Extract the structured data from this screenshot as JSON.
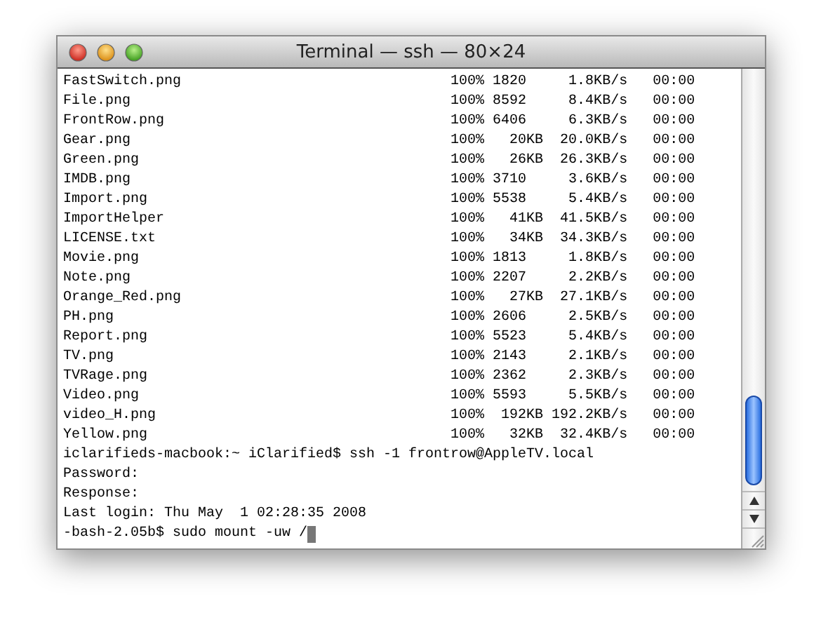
{
  "window": {
    "title": "Terminal — ssh — 80×24"
  },
  "lines": [
    "FastSwitch.png                                100% 1820     1.8KB/s   00:00",
    "File.png                                      100% 8592     8.4KB/s   00:00",
    "FrontRow.png                                  100% 6406     6.3KB/s   00:00",
    "Gear.png                                      100%   20KB  20.0KB/s   00:00",
    "Green.png                                     100%   26KB  26.3KB/s   00:00",
    "IMDB.png                                      100% 3710     3.6KB/s   00:00",
    "Import.png                                    100% 5538     5.4KB/s   00:00",
    "ImportHelper                                  100%   41KB  41.5KB/s   00:00",
    "LICENSE.txt                                   100%   34KB  34.3KB/s   00:00",
    "Movie.png                                     100% 1813     1.8KB/s   00:00",
    "Note.png                                      100% 2207     2.2KB/s   00:00",
    "Orange_Red.png                                100%   27KB  27.1KB/s   00:00",
    "PH.png                                        100% 2606     2.5KB/s   00:00",
    "Report.png                                    100% 5523     5.4KB/s   00:00",
    "TV.png                                        100% 2143     2.1KB/s   00:00",
    "TVRage.png                                    100% 2362     2.3KB/s   00:00",
    "Video.png                                     100% 5593     5.5KB/s   00:00",
    "video_H.png                                   100%  192KB 192.2KB/s   00:00",
    "Yellow.png                                    100%   32KB  32.4KB/s   00:00",
    "iclarifieds-macbook:~ iClarified$ ssh -1 frontrow@AppleTV.local",
    "Password:",
    "Response:",
    "Last login: Thu May  1 02:28:35 2008",
    "-bash-2.05b$ sudo mount -uw /"
  ]
}
